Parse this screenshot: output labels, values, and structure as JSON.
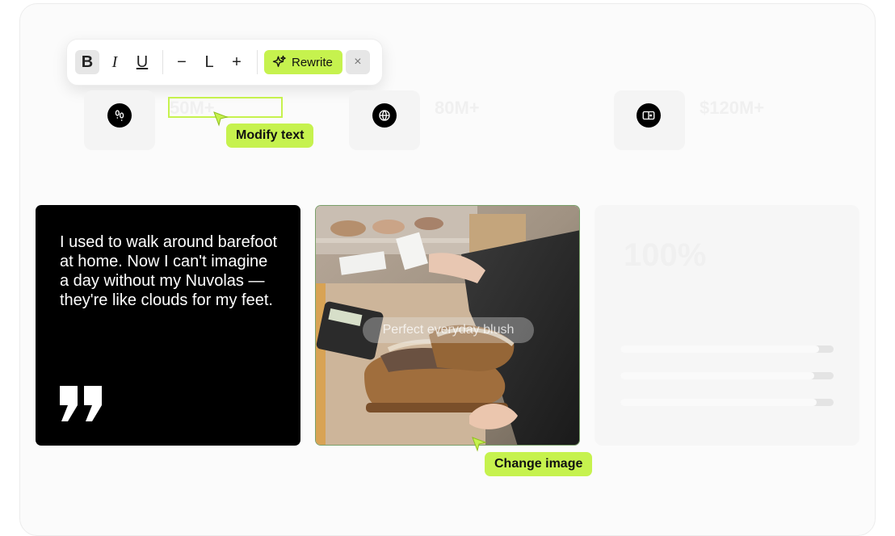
{
  "toolbar": {
    "bold_label": "B",
    "italic_label": "I",
    "underline_label": "U",
    "decrease_label": "−",
    "size_label": "L",
    "increase_label": "+",
    "rewrite_label": "Rewrite",
    "close_label": "×"
  },
  "stats": [
    {
      "value": "50M+",
      "icon": "footprints-icon"
    },
    {
      "value": "80M+",
      "icon": "basketball-icon"
    },
    {
      "value": "$120M+",
      "icon": "wallet-icon"
    }
  ],
  "annotations": {
    "modify_text": "Modify text",
    "change_image": "Change image"
  },
  "quote_card": {
    "text": "I used to walk around barefoot at home. Now I can't imagine a day without my Nuvolas — they're like clouds for my feet.",
    "icon": "quote-icon"
  },
  "photo_card": {
    "caption": "Perfect everyday blush"
  },
  "ghost_card": {
    "big_value": "100%",
    "bars": [
      0.93,
      0.91,
      0.92
    ]
  },
  "colors": {
    "accent": "#c6f24e",
    "dark": "#000000"
  }
}
